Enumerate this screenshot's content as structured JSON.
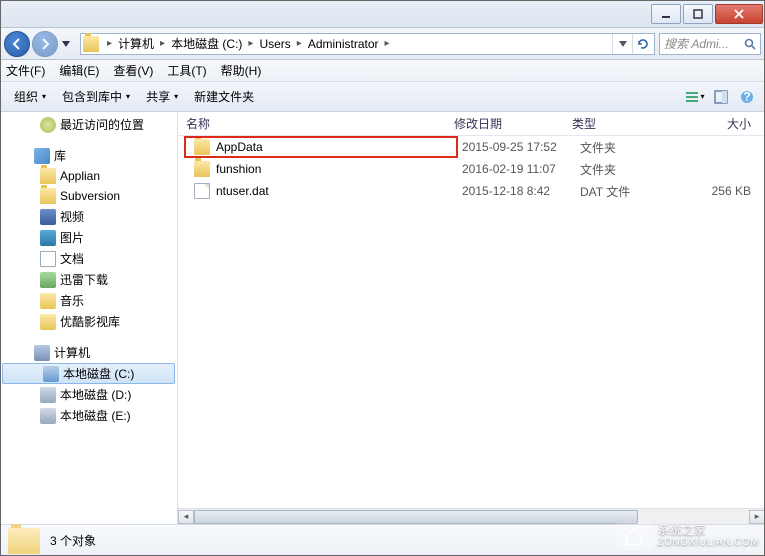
{
  "breadcrumbs": [
    "计算机",
    "本地磁盘 (C:)",
    "Users",
    "Administrator"
  ],
  "search": {
    "placeholder": "搜索 Admi..."
  },
  "menus": {
    "file": "文件(F)",
    "edit": "编辑(E)",
    "view": "查看(V)",
    "tools": "工具(T)",
    "help": "帮助(H)"
  },
  "toolbar": {
    "organize": "组织",
    "include": "包含到库中",
    "share": "共享",
    "newfolder": "新建文件夹"
  },
  "columns": {
    "name": "名称",
    "date": "修改日期",
    "type": "类型",
    "size": "大小"
  },
  "sidebar": {
    "recent": "最近访问的位置",
    "libraries": "库",
    "lib_items": [
      "Applian",
      "Subversion",
      "视频",
      "图片",
      "文档",
      "迅雷下载",
      "音乐",
      "优酷影视库"
    ],
    "computer": "计算机",
    "drives": [
      "本地磁盘 (C:)",
      "本地磁盘 (D:)",
      "本地磁盘 (E:)"
    ]
  },
  "files": [
    {
      "name": "AppData",
      "date": "2015-09-25 17:52",
      "type": "文件夹",
      "size": "",
      "icon": "folder"
    },
    {
      "name": "funshion",
      "date": "2016-02-19 11:07",
      "type": "文件夹",
      "size": "",
      "icon": "folder"
    },
    {
      "name": "ntuser.dat",
      "date": "2015-12-18 8:42",
      "type": "DAT 文件",
      "size": "256 KB",
      "icon": "file"
    }
  ],
  "status": {
    "text": "3 个对象"
  },
  "watermark": {
    "title": "系统之家",
    "sub": "ZONGXIULIAN.COM"
  }
}
